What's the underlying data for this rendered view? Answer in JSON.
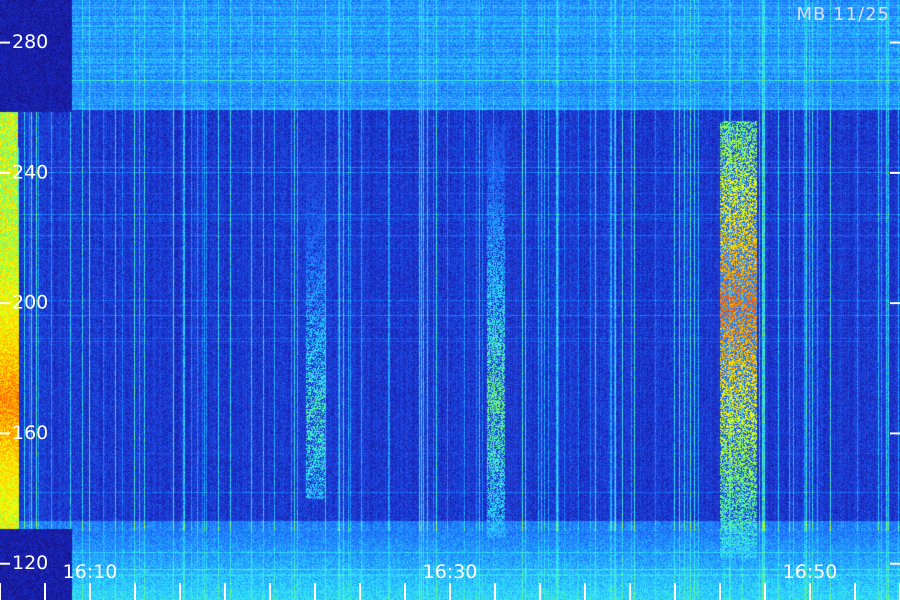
{
  "caption": "MB 11/25",
  "chart_data": {
    "type": "heatmap",
    "title": "",
    "xlabel": "",
    "ylabel": "",
    "x_ticks": [
      "16:10",
      "16:30",
      "16:50"
    ],
    "x_range": [
      "16:05",
      "16:55"
    ],
    "y_ticks": [
      120,
      160,
      200,
      240,
      280
    ],
    "y_range": [
      115,
      290
    ],
    "colormap": [
      "#14005a",
      "#1a2cc8",
      "#1e78ff",
      "#2ee4ff",
      "#7cff5a",
      "#ffff00",
      "#ff8a00",
      "#ff2000"
    ],
    "background_color": "#1a0a55",
    "features": [
      {
        "type": "broadband",
        "time_start": "16:05",
        "time_end": "16:06",
        "freq_low": 120,
        "freq_high": 248,
        "intensity_max": 0.95,
        "peak_freq": 170
      },
      {
        "type": "burst_group",
        "time_start": "16:45",
        "time_end": "16:47",
        "freq_low": 122,
        "freq_high": 256,
        "intensity_max": 0.98,
        "peak_freq": 200
      },
      {
        "type": "burst_group",
        "time_start": "16:32",
        "time_end": "16:33",
        "freq_low": 128,
        "freq_high": 255,
        "intensity_max": 0.6,
        "peak_freq": 170
      },
      {
        "type": "burst_group",
        "time_start": "16:22",
        "time_end": "16:23",
        "freq_low": 140,
        "freq_high": 250,
        "intensity_max": 0.55,
        "peak_freq": 165
      }
    ],
    "grid": false,
    "legend": "none"
  }
}
